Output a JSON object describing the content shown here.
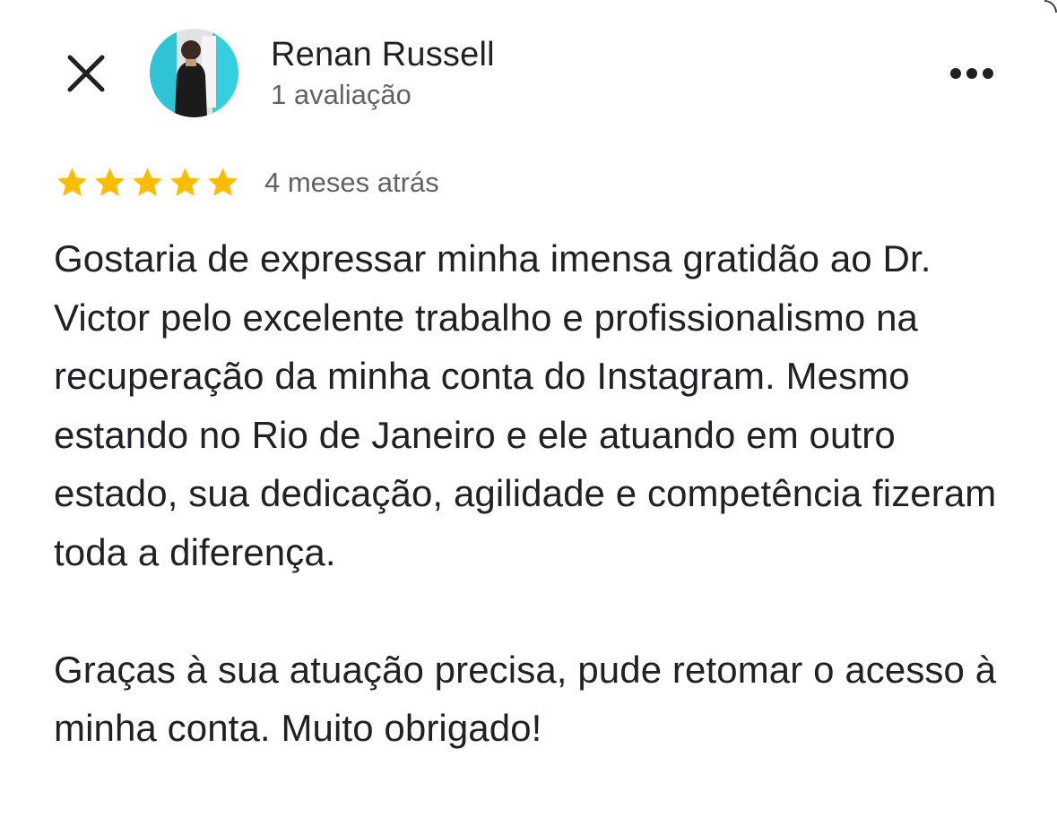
{
  "header": {
    "close_icon": "close-icon",
    "reviewer_name": "Renan Russell",
    "reviewer_review_count": "1 avaliação",
    "more_icon": "more-horizontal-icon"
  },
  "review": {
    "rating": 5,
    "max_rating": 5,
    "star_color": "#fbbc04",
    "date": "4 meses atrás",
    "text": "Gostaria de expressar minha imensa gratidão ao Dr. Victor pelo excelente trabalho e profissionalismo na recuperação da minha conta do Instagram. Mesmo estando no Rio de Janeiro e ele atuando em outro estado, sua dedicação, agilidade e competência fizeram toda a diferença.\n\nGraças à sua atuação precisa, pude retomar o acesso à minha conta. Muito obrigado!"
  }
}
